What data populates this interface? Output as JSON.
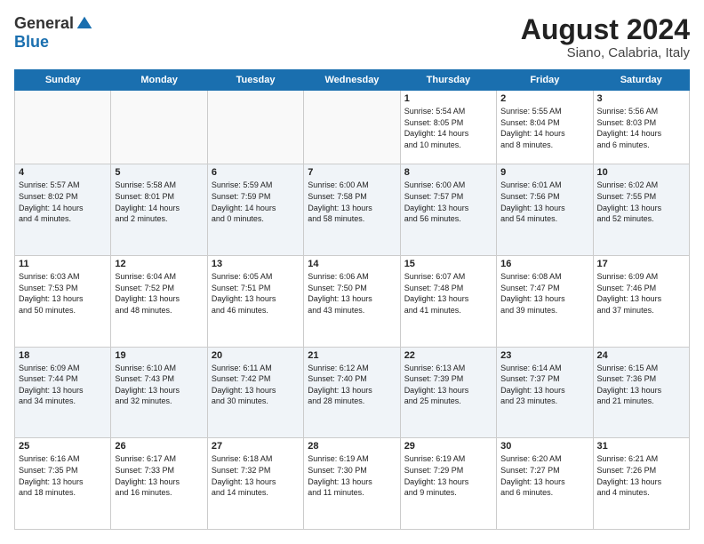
{
  "header": {
    "logo_general": "General",
    "logo_blue": "Blue",
    "month_title": "August 2024",
    "location": "Siano, Calabria, Italy"
  },
  "weekdays": [
    "Sunday",
    "Monday",
    "Tuesday",
    "Wednesday",
    "Thursday",
    "Friday",
    "Saturday"
  ],
  "weeks": [
    [
      {
        "day": "",
        "info": ""
      },
      {
        "day": "",
        "info": ""
      },
      {
        "day": "",
        "info": ""
      },
      {
        "day": "",
        "info": ""
      },
      {
        "day": "1",
        "info": "Sunrise: 5:54 AM\nSunset: 8:05 PM\nDaylight: 14 hours\nand 10 minutes."
      },
      {
        "day": "2",
        "info": "Sunrise: 5:55 AM\nSunset: 8:04 PM\nDaylight: 14 hours\nand 8 minutes."
      },
      {
        "day": "3",
        "info": "Sunrise: 5:56 AM\nSunset: 8:03 PM\nDaylight: 14 hours\nand 6 minutes."
      }
    ],
    [
      {
        "day": "4",
        "info": "Sunrise: 5:57 AM\nSunset: 8:02 PM\nDaylight: 14 hours\nand 4 minutes."
      },
      {
        "day": "5",
        "info": "Sunrise: 5:58 AM\nSunset: 8:01 PM\nDaylight: 14 hours\nand 2 minutes."
      },
      {
        "day": "6",
        "info": "Sunrise: 5:59 AM\nSunset: 7:59 PM\nDaylight: 14 hours\nand 0 minutes."
      },
      {
        "day": "7",
        "info": "Sunrise: 6:00 AM\nSunset: 7:58 PM\nDaylight: 13 hours\nand 58 minutes."
      },
      {
        "day": "8",
        "info": "Sunrise: 6:00 AM\nSunset: 7:57 PM\nDaylight: 13 hours\nand 56 minutes."
      },
      {
        "day": "9",
        "info": "Sunrise: 6:01 AM\nSunset: 7:56 PM\nDaylight: 13 hours\nand 54 minutes."
      },
      {
        "day": "10",
        "info": "Sunrise: 6:02 AM\nSunset: 7:55 PM\nDaylight: 13 hours\nand 52 minutes."
      }
    ],
    [
      {
        "day": "11",
        "info": "Sunrise: 6:03 AM\nSunset: 7:53 PM\nDaylight: 13 hours\nand 50 minutes."
      },
      {
        "day": "12",
        "info": "Sunrise: 6:04 AM\nSunset: 7:52 PM\nDaylight: 13 hours\nand 48 minutes."
      },
      {
        "day": "13",
        "info": "Sunrise: 6:05 AM\nSunset: 7:51 PM\nDaylight: 13 hours\nand 46 minutes."
      },
      {
        "day": "14",
        "info": "Sunrise: 6:06 AM\nSunset: 7:50 PM\nDaylight: 13 hours\nand 43 minutes."
      },
      {
        "day": "15",
        "info": "Sunrise: 6:07 AM\nSunset: 7:48 PM\nDaylight: 13 hours\nand 41 minutes."
      },
      {
        "day": "16",
        "info": "Sunrise: 6:08 AM\nSunset: 7:47 PM\nDaylight: 13 hours\nand 39 minutes."
      },
      {
        "day": "17",
        "info": "Sunrise: 6:09 AM\nSunset: 7:46 PM\nDaylight: 13 hours\nand 37 minutes."
      }
    ],
    [
      {
        "day": "18",
        "info": "Sunrise: 6:09 AM\nSunset: 7:44 PM\nDaylight: 13 hours\nand 34 minutes."
      },
      {
        "day": "19",
        "info": "Sunrise: 6:10 AM\nSunset: 7:43 PM\nDaylight: 13 hours\nand 32 minutes."
      },
      {
        "day": "20",
        "info": "Sunrise: 6:11 AM\nSunset: 7:42 PM\nDaylight: 13 hours\nand 30 minutes."
      },
      {
        "day": "21",
        "info": "Sunrise: 6:12 AM\nSunset: 7:40 PM\nDaylight: 13 hours\nand 28 minutes."
      },
      {
        "day": "22",
        "info": "Sunrise: 6:13 AM\nSunset: 7:39 PM\nDaylight: 13 hours\nand 25 minutes."
      },
      {
        "day": "23",
        "info": "Sunrise: 6:14 AM\nSunset: 7:37 PM\nDaylight: 13 hours\nand 23 minutes."
      },
      {
        "day": "24",
        "info": "Sunrise: 6:15 AM\nSunset: 7:36 PM\nDaylight: 13 hours\nand 21 minutes."
      }
    ],
    [
      {
        "day": "25",
        "info": "Sunrise: 6:16 AM\nSunset: 7:35 PM\nDaylight: 13 hours\nand 18 minutes."
      },
      {
        "day": "26",
        "info": "Sunrise: 6:17 AM\nSunset: 7:33 PM\nDaylight: 13 hours\nand 16 minutes."
      },
      {
        "day": "27",
        "info": "Sunrise: 6:18 AM\nSunset: 7:32 PM\nDaylight: 13 hours\nand 14 minutes."
      },
      {
        "day": "28",
        "info": "Sunrise: 6:19 AM\nSunset: 7:30 PM\nDaylight: 13 hours\nand 11 minutes."
      },
      {
        "day": "29",
        "info": "Sunrise: 6:19 AM\nSunset: 7:29 PM\nDaylight: 13 hours\nand 9 minutes."
      },
      {
        "day": "30",
        "info": "Sunrise: 6:20 AM\nSunset: 7:27 PM\nDaylight: 13 hours\nand 6 minutes."
      },
      {
        "day": "31",
        "info": "Sunrise: 6:21 AM\nSunset: 7:26 PM\nDaylight: 13 hours\nand 4 minutes."
      }
    ]
  ]
}
